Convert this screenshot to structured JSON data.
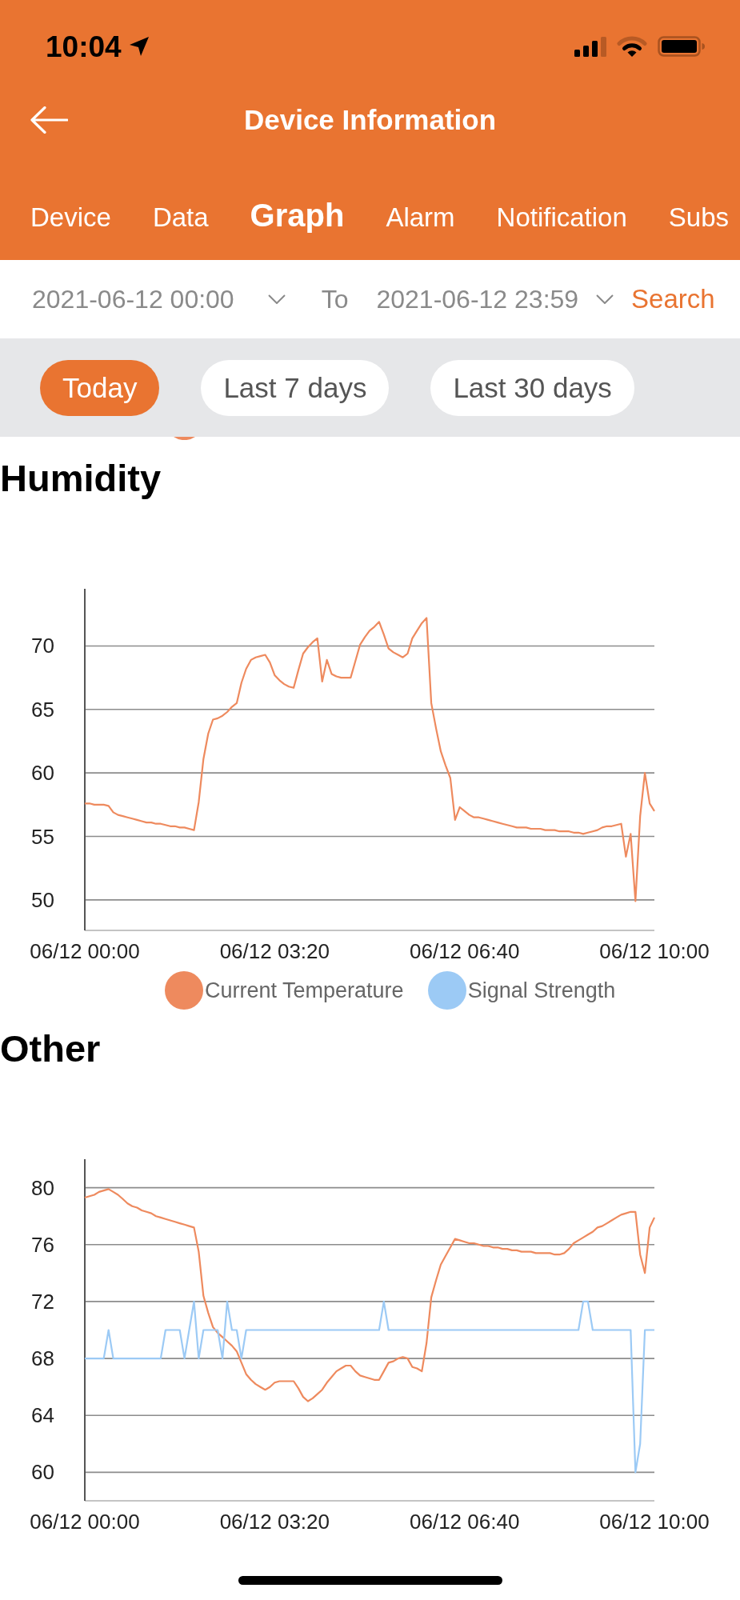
{
  "status_bar": {
    "time": "10:04"
  },
  "header": {
    "title": "Device Information"
  },
  "tabs": [
    {
      "label": "Device",
      "selected": false
    },
    {
      "label": "Data",
      "selected": false
    },
    {
      "label": "Graph",
      "selected": true
    },
    {
      "label": "Alarm",
      "selected": false
    },
    {
      "label": "Notification",
      "selected": false
    },
    {
      "label": "Subs",
      "selected": false
    }
  ],
  "date_range": {
    "start": "2021-06-12 00:00",
    "separator": "To",
    "end": "2021-06-12 23:59",
    "search": "Search"
  },
  "quick_ranges": [
    {
      "label": "Today",
      "selected": true
    },
    {
      "label": "Last 7 days",
      "selected": false
    },
    {
      "label": "Last 30 days",
      "selected": false
    }
  ],
  "sections": [
    {
      "title": "Humidity",
      "chart_data": {
        "type": "line",
        "grid": true,
        "categories": [
          "06/12 00:00",
          null,
          null,
          null,
          null,
          null,
          null,
          null,
          null,
          null,
          null,
          null,
          null,
          null,
          null,
          null,
          null,
          null,
          null,
          null,
          null,
          null,
          null,
          null,
          null,
          null,
          null,
          null,
          null,
          null,
          null,
          null,
          null,
          null,
          null,
          null,
          null,
          null,
          null,
          null,
          "06/12 03:20",
          null,
          null,
          null,
          null,
          null,
          null,
          null,
          null,
          null,
          null,
          null,
          null,
          null,
          null,
          null,
          null,
          null,
          null,
          null,
          null,
          null,
          null,
          null,
          null,
          null,
          null,
          null,
          null,
          null,
          null,
          null,
          null,
          null,
          null,
          null,
          null,
          null,
          null,
          null,
          "06/12 06:40",
          null,
          null,
          null,
          null,
          null,
          null,
          null,
          null,
          null,
          null,
          null,
          null,
          null,
          null,
          null,
          null,
          null,
          null,
          null,
          null,
          null,
          null,
          null,
          null,
          null,
          null,
          null,
          null,
          null,
          null,
          null,
          null,
          null,
          null,
          null,
          null,
          null,
          null,
          null,
          "06/12 10:00"
        ],
        "ylim": [
          47.6,
          74.5
        ],
        "yticks": [
          50,
          55,
          60,
          65,
          70
        ],
        "series": [
          {
            "color": "#ee8a5e",
            "values": [
              57.6,
              57.6,
              57.5,
              57.5,
              57.5,
              57.4,
              56.9,
              56.7,
              56.6,
              56.5,
              56.4,
              56.3,
              56.2,
              56.1,
              56.1,
              56.0,
              56.0,
              55.9,
              55.8,
              55.8,
              55.7,
              55.7,
              55.6,
              55.5,
              57.7,
              61.1,
              63.1,
              64.2,
              64.3,
              64.5,
              64.8,
              65.2,
              65.5,
              67.1,
              68.2,
              68.9,
              69.1,
              69.2,
              69.3,
              68.7,
              67.7,
              67.3,
              67.0,
              66.8,
              66.7,
              68.1,
              69.4,
              69.9,
              70.3,
              70.6,
              67.2,
              68.9,
              67.8,
              67.6,
              67.5,
              67.5,
              67.5,
              68.8,
              70.1,
              70.7,
              71.2,
              71.5,
              71.9,
              70.9,
              69.8,
              69.5,
              69.3,
              69.1,
              69.4,
              70.6,
              71.2,
              71.8,
              72.2,
              65.5,
              63.5,
              61.7,
              60.6,
              59.6,
              56.3,
              57.3,
              57.0,
              56.7,
              56.5,
              56.5,
              56.4,
              56.3,
              56.2,
              56.1,
              56.0,
              55.9,
              55.8,
              55.7,
              55.7,
              55.7,
              55.6,
              55.6,
              55.6,
              55.5,
              55.5,
              55.5,
              55.4,
              55.4,
              55.4,
              55.3,
              55.3,
              55.2,
              55.3,
              55.4,
              55.5,
              55.7,
              55.8,
              55.8,
              55.9,
              56.0,
              53.4,
              55.2,
              49.9,
              56.6,
              60,
              57.6,
              57.0
            ]
          }
        ]
      },
      "legend": [
        {
          "label": "Current Temperature",
          "color": "#ee8a5e"
        },
        {
          "label": "Signal Strength",
          "color": "#9ccaf5"
        }
      ]
    },
    {
      "title": "Other",
      "chart_data": {
        "type": "line",
        "grid": true,
        "categories": [
          "06/12 00:00",
          null,
          null,
          null,
          null,
          null,
          null,
          null,
          null,
          null,
          null,
          null,
          null,
          null,
          null,
          null,
          null,
          null,
          null,
          null,
          null,
          null,
          null,
          null,
          null,
          null,
          null,
          null,
          null,
          null,
          null,
          null,
          null,
          null,
          null,
          null,
          null,
          null,
          null,
          null,
          "06/12 03:20",
          null,
          null,
          null,
          null,
          null,
          null,
          null,
          null,
          null,
          null,
          null,
          null,
          null,
          null,
          null,
          null,
          null,
          null,
          null,
          null,
          null,
          null,
          null,
          null,
          null,
          null,
          null,
          null,
          null,
          null,
          null,
          null,
          null,
          null,
          null,
          null,
          null,
          null,
          null,
          "06/12 06:40",
          null,
          null,
          null,
          null,
          null,
          null,
          null,
          null,
          null,
          null,
          null,
          null,
          null,
          null,
          null,
          null,
          null,
          null,
          null,
          null,
          null,
          null,
          null,
          null,
          null,
          null,
          null,
          null,
          null,
          null,
          null,
          null,
          null,
          null,
          null,
          null,
          null,
          null,
          null,
          "06/12 10:00"
        ],
        "ylim": [
          58,
          82
        ],
        "yticks": [
          60,
          64,
          68,
          72,
          76,
          80
        ],
        "series": [
          {
            "color": "#ee8a5e",
            "values": [
              79.3,
              79.4,
              79.5,
              79.7,
              79.8,
              79.9,
              79.7,
              79.5,
              79.2,
              78.9,
              78.7,
              78.6,
              78.4,
              78.3,
              78.2,
              78.0,
              77.9,
              77.8,
              77.7,
              77.6,
              77.5,
              77.4,
              77.3,
              77.2,
              75.5,
              72.4,
              71.2,
              70.2,
              69.8,
              69.5,
              69.2,
              68.9,
              68.5,
              67.7,
              66.9,
              66.5,
              66.2,
              66.0,
              65.8,
              66.0,
              66.3,
              66.4,
              66.4,
              66.4,
              66.4,
              65.9,
              65.3,
              65.0,
              65.2,
              65.5,
              65.8,
              66.3,
              66.7,
              67.1,
              67.3,
              67.5,
              67.5,
              67.1,
              66.8,
              66.7,
              66.6,
              66.5,
              66.5,
              67.1,
              67.7,
              67.8,
              68.0,
              68.1,
              68.0,
              67.4,
              67.3,
              67.1,
              69.1,
              72.3,
              73.5,
              74.6,
              75.2,
              75.8,
              76.4,
              76.3,
              76.2,
              76.1,
              76.1,
              76.0,
              75.9,
              75.9,
              75.8,
              75.8,
              75.7,
              75.7,
              75.6,
              75.6,
              75.5,
              75.5,
              75.5,
              75.4,
              75.4,
              75.4,
              75.4,
              75.3,
              75.3,
              75.4,
              75.7,
              76.1,
              76.3,
              76.5,
              76.7,
              76.9,
              77.2,
              77.3,
              77.5,
              77.7,
              77.9,
              78.1,
              78.2,
              78.3,
              78.3,
              75.3,
              74.0,
              77.2,
              77.9
            ]
          },
          {
            "color": "#9ccaf5",
            "values": [
              68,
              68,
              68,
              68,
              68,
              70,
              68,
              68,
              68,
              68,
              68,
              68,
              68,
              68,
              68,
              68,
              68,
              70,
              70,
              70,
              70,
              68,
              70,
              72,
              68,
              70,
              70,
              70,
              70,
              68,
              72,
              70,
              70,
              68,
              70,
              70,
              70,
              70,
              70,
              70,
              70,
              70,
              70,
              70,
              70,
              70,
              70,
              70,
              70,
              70,
              70,
              70,
              70,
              70,
              70,
              70,
              70,
              70,
              70,
              70,
              70,
              70,
              70,
              72,
              70,
              70,
              70,
              70,
              70,
              70,
              70,
              70,
              70,
              70,
              70,
              70,
              70,
              70,
              70,
              70,
              70,
              70,
              70,
              70,
              70,
              70,
              70,
              70,
              70,
              70,
              70,
              70,
              70,
              70,
              70,
              70,
              70,
              70,
              70,
              70,
              70,
              70,
              70,
              70,
              70,
              72,
              72,
              70,
              70,
              70,
              70,
              70,
              70,
              70,
              70,
              70,
              60,
              62,
              70,
              70,
              70
            ]
          }
        ]
      }
    }
  ]
}
